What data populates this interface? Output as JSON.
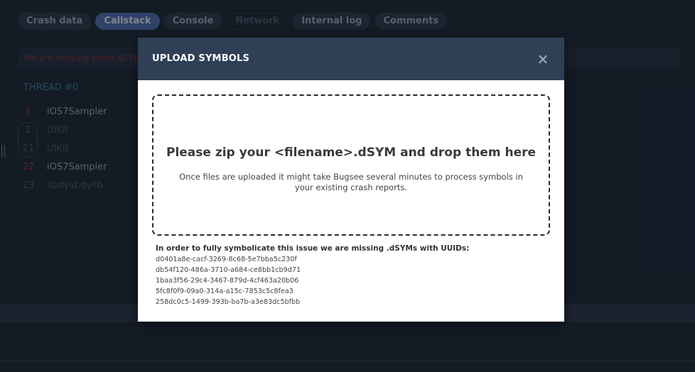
{
  "tabs": [
    {
      "label": "Crash data",
      "state": "normal"
    },
    {
      "label": "Callstack",
      "state": "active"
    },
    {
      "label": "Console",
      "state": "normal"
    },
    {
      "label": "Network",
      "state": "disabled"
    },
    {
      "label": "Internal log",
      "state": "normal"
    },
    {
      "label": "Comments",
      "state": "normal"
    }
  ],
  "warning": {
    "text": "We are missing some dSYM f"
  },
  "thread": {
    "title": "THREAD #0"
  },
  "frames": [
    {
      "num": "1",
      "name": "iOS7Sampler"
    },
    {
      "num": "2",
      "name": "UIKit"
    },
    {
      "num": "21",
      "name": "UIKit"
    },
    {
      "num": "22",
      "name": "iOS7Sampler"
    },
    {
      "num": "23",
      "name": "libdyld.dylib"
    }
  ],
  "modal": {
    "title": "UPLOAD SYMBOLS",
    "close_icon": "×",
    "drop_title": "Please zip your <filename>.dSYM and drop them here",
    "drop_subtitle": "Once files are uploaded it might take Bugsee several minutes to process symbols in your existing crash reports.",
    "missing_label": "In order to fully symbolicate this issue we are missing .dSYMs with UUIDs:",
    "uuids": [
      "d0401a8e-cacf-3269-8c68-5e7bba5c230f",
      "db54f120-486a-3710-a684-ce8bb1cb9d71",
      "1baa3f56-29c4-3467-879d-4cf463a20b06",
      "5fc8f0f9-09a0-314a-a15c-7853c5c8fea3",
      "258dc0c5-1499-393b-ba7b-a3e83dc5bfbb"
    ]
  },
  "colors": {
    "frame_num_red": "#9e3438",
    "frame_num_dim": "#4d5a6a",
    "frame_name_bright": "#9aa6b4",
    "frame_name_dim": "#4d5a6a"
  }
}
